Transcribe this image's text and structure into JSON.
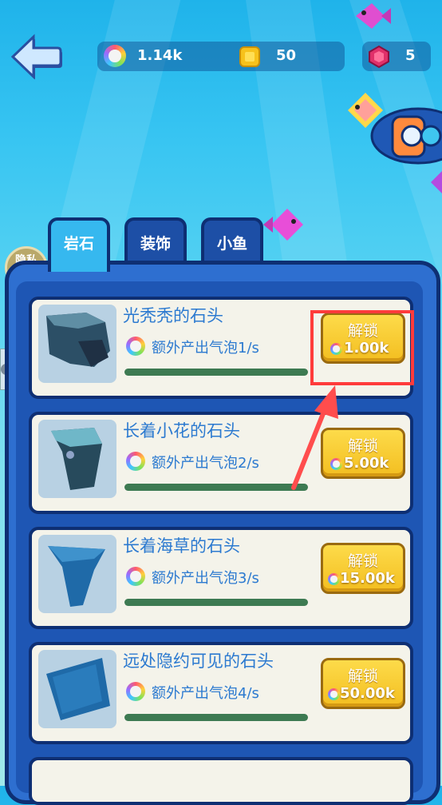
{
  "top_bar": {
    "bubbles": "1.14k",
    "coins": "50",
    "gems": "5"
  },
  "privacy": {
    "label": "隐私政策"
  },
  "tabs": [
    {
      "label": "岩石",
      "active": true
    },
    {
      "label": "装饰",
      "active": false
    },
    {
      "label": "小鱼",
      "active": false
    }
  ],
  "items": [
    {
      "name": "光秃秃的石头",
      "bonus": "额外产出气泡1/s",
      "unlock_label": "解锁",
      "cost": "1.00k"
    },
    {
      "name": "长着小花的石头",
      "bonus": "额外产出气泡2/s",
      "unlock_label": "解锁",
      "cost": "5.00k"
    },
    {
      "name": "长着海草的石头",
      "bonus": "额外产出气泡3/s",
      "unlock_label": "解锁",
      "cost": "15.00k"
    },
    {
      "name": "远处隐约可见的石头",
      "bonus": "额外产出气泡4/s",
      "unlock_label": "解锁",
      "cost": "50.00k"
    }
  ],
  "colors": {
    "accent_blue": "#2c7ad0",
    "button_gold": "#f3be20",
    "highlight_red": "#ff3b3b"
  }
}
